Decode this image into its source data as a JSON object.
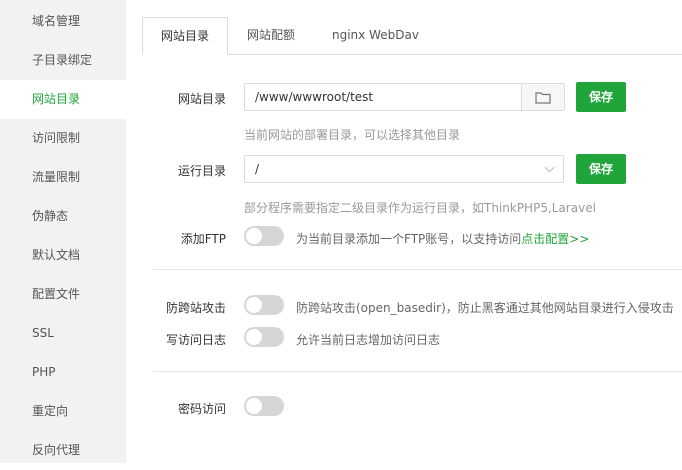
{
  "sidebar": {
    "items": [
      {
        "label": "域名管理"
      },
      {
        "label": "子目录绑定"
      },
      {
        "label": "网站目录"
      },
      {
        "label": "访问限制"
      },
      {
        "label": "流量限制"
      },
      {
        "label": "伪静态"
      },
      {
        "label": "默认文档"
      },
      {
        "label": "配置文件"
      },
      {
        "label": "SSL"
      },
      {
        "label": "PHP"
      },
      {
        "label": "重定向"
      },
      {
        "label": "反向代理"
      }
    ],
    "active_index": 2
  },
  "tabs": [
    {
      "label": "网站目录"
    },
    {
      "label": "网站配额"
    },
    {
      "label": "nginx WebDav"
    }
  ],
  "site_dir": {
    "label": "网站目录",
    "value": "/www/wwwroot/test",
    "save_label": "保存",
    "hint": "当前网站的部署目录，可以选择其他目录"
  },
  "run_dir": {
    "label": "运行目录",
    "value": "/",
    "save_label": "保存",
    "hint": "部分程序需要指定二级目录作为运行目录，如ThinkPHP5,Laravel"
  },
  "add_ftp": {
    "label": "添加FTP",
    "desc": "为当前目录添加一个FTP账号，以支持访问",
    "link": "点击配置>>"
  },
  "anti_xss": {
    "label": "防跨站攻击",
    "desc": "防跨站攻击(open_basedir)，防止黑客通过其他网站目录进行入侵攻击"
  },
  "access_log": {
    "label": "写访问日志",
    "desc": "允许当前日志增加访问日志"
  },
  "password_access": {
    "label": "密码访问"
  },
  "colors": {
    "accent": "#20a53a",
    "sidebar_bg": "#f2f2f2",
    "switch_off": "#d6d6d6"
  }
}
